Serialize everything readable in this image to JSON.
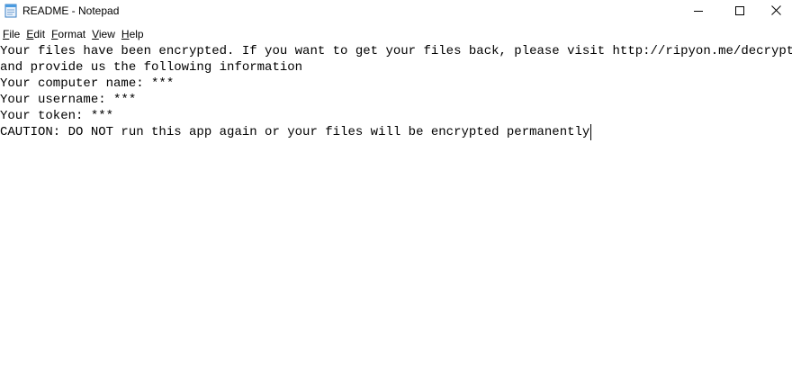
{
  "window": {
    "title": "README - Notepad",
    "controls": {
      "minimize_icon": "minimize-icon",
      "maximize_icon": "maximize-icon",
      "close_icon": "close-icon"
    }
  },
  "menu": {
    "items": [
      {
        "mnemonic": "F",
        "rest": "ile"
      },
      {
        "mnemonic": "E",
        "rest": "dit"
      },
      {
        "mnemonic": "F",
        "rest": "ormat"
      },
      {
        "mnemonic": "V",
        "rest": "iew"
      },
      {
        "mnemonic": "H",
        "rest": "elp"
      }
    ]
  },
  "document": {
    "lines": [
      "Your files have been encrypted. If you want to get your files back, please visit http://ripyon.me/decrypt",
      "and provide us the following information",
      "Your computer name: ***",
      "Your username: ***",
      "Your token: ***",
      "CAUTION: DO NOT run this app again or your files will be encrypted permanently"
    ]
  },
  "colors": {
    "text": "#000000",
    "background": "#ffffff",
    "icon_blue": "#4a9be0"
  }
}
